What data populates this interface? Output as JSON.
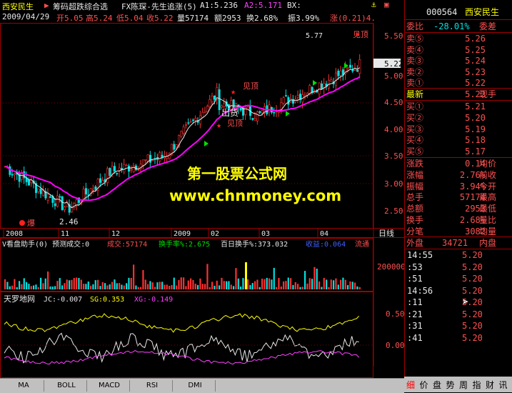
{
  "header": {
    "stock_name": "西安民生",
    "formula_name": "筹码超跌综合选",
    "indicator_label": "FX陈琛-先生追涨(5)",
    "a1": "A1:5.236",
    "a2": "A2:5.171",
    "bx": "BX:"
  },
  "quote_bar": {
    "date": "2009/04/29",
    "open": "开5.05",
    "high": "高5.24",
    "low": "低5.04",
    "close": "收5.22",
    "volume": "量57174",
    "amount": "额2953",
    "turnover": "换2.68%",
    "amplitude": "振3.99%",
    "change": "涨(0.21)4."
  },
  "main_chart": {
    "price_axis": [
      "5.50",
      "5.22",
      "5.00",
      "4.50",
      "4.00",
      "3.50",
      "3.00",
      "2.50"
    ],
    "last_price_tag": "5.22",
    "annotations": {
      "top_price": "5.77",
      "peak_label": "见顶",
      "low_price": "2.46",
      "burst_label": "爆",
      "chuhuo_label": "出货",
      "jianding_mid": "见顶",
      "jianding_low": "见顶"
    },
    "date_axis": [
      "2008",
      "11",
      "12",
      "2009",
      "02",
      "03",
      "04"
    ],
    "period_label": "日线"
  },
  "volume_panel": {
    "title": "V看盘助手(0) 预测成交:0",
    "chengjiao": "成交:57174",
    "huanshou": "换手率%:2.675",
    "bairi": "百日换手%:373.032",
    "shouyi": "收益:0.064",
    "liutong": "流通",
    "axis": "200000"
  },
  "tianluo_panel": {
    "title": "天罗地网",
    "jc": "JC:-0.007",
    "sg": "SG:0.353",
    "xg": "XG:-0.149",
    "axis": [
      "0.50",
      "0.00"
    ]
  },
  "indicator_tabs": [
    "MA",
    "BOLL",
    "MACD",
    "RSI",
    "DMI"
  ],
  "right_panel": {
    "code": "000564",
    "name": "西安民生",
    "weibi_label": "委比",
    "weibi_value": "-28.01%",
    "weicha_label": "委差",
    "sells": [
      {
        "label": "卖⑤",
        "price": "5.26",
        "vol": ""
      },
      {
        "label": "卖④",
        "price": "5.25",
        "vol": ""
      },
      {
        "label": "卖③",
        "price": "5.24",
        "vol": ""
      },
      {
        "label": "卖②",
        "price": "5.23",
        "vol": ""
      },
      {
        "label": "卖①",
        "price": "5.22",
        "vol": ""
      }
    ],
    "latest_label": "最新",
    "latest_value": "5.22",
    "latest_suffix": "现手",
    "buys": [
      {
        "label": "买①",
        "price": "5.21"
      },
      {
        "label": "买②",
        "price": "5.20"
      },
      {
        "label": "买③",
        "price": "5.19"
      },
      {
        "label": "买④",
        "price": "5.18"
      },
      {
        "label": "买⑤",
        "price": "5.17"
      }
    ],
    "stats": [
      {
        "label": "涨跌",
        "value": "0.14",
        "suffix": "均价"
      },
      {
        "label": "涨幅",
        "value": "2.76%",
        "suffix": "前收"
      },
      {
        "label": "振幅",
        "value": "3.94%",
        "suffix": "今开"
      },
      {
        "label": "总手",
        "value": "57174",
        "suffix": "最高"
      },
      {
        "label": "总额",
        "value": "2953",
        "suffix": "最低"
      },
      {
        "label": "换手",
        "value": "2.68%",
        "suffix": "量比"
      },
      {
        "label": "分笔",
        "value": "3082",
        "suffix": "均量"
      }
    ],
    "waipan_label": "外盘",
    "waipan_value": "34721",
    "neipan_label": "内盘",
    "ticks": [
      {
        "time": "14:55",
        "price": "5.20"
      },
      {
        "time": ":53",
        "price": "5.20"
      },
      {
        "time": ":51",
        "price": "5.20"
      },
      {
        "time": "14:56",
        "price": "5.20"
      },
      {
        "time": ":11",
        "price": "5.20"
      },
      {
        "time": ":21",
        "price": "5.20"
      },
      {
        "time": ":31",
        "price": "5.20"
      },
      {
        "time": ":41",
        "price": "5.20"
      }
    ],
    "bottom_tabs": [
      "细",
      "价",
      "盘",
      "势",
      "周",
      "指",
      "财",
      "讯"
    ]
  },
  "watermark": {
    "line1": "第一股票公式网",
    "line2": "www.chnmoney.com"
  },
  "colors": {
    "up": "#ff5050",
    "down": "#00ffff",
    "ma_white": "#e8e8e8",
    "ma_magenta": "#ff00ff",
    "watermark": "#ffff00"
  }
}
